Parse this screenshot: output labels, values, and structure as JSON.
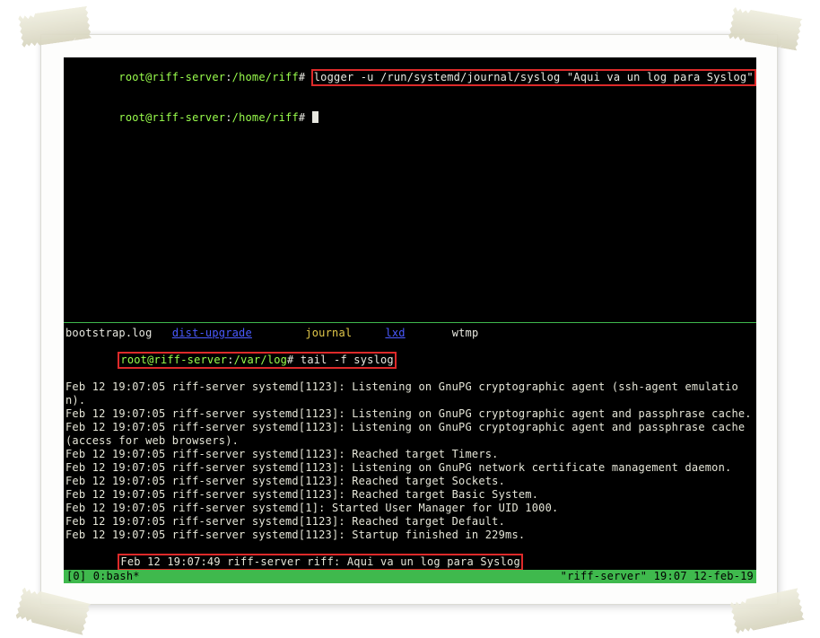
{
  "top_pane": {
    "prompt1": {
      "user_host": "root@riff-server",
      "colon": ":",
      "path": "/home/riff",
      "hash": "# ",
      "command": "logger -u /run/systemd/journal/syslog \"Aqui va un log para Syslog\""
    },
    "prompt2": {
      "user_host": "root@riff-server",
      "colon": ":",
      "path": "/home/riff",
      "hash": "# "
    }
  },
  "bottom_pane": {
    "ls_entries": [
      {
        "text": "bootstrap.log",
        "cls": "ls-white"
      },
      {
        "text": "dist-upgrade",
        "cls": "ls-blue"
      },
      {
        "text": "journal",
        "cls": "ls-yellow"
      },
      {
        "text": "lxd",
        "cls": "ls-blue"
      },
      {
        "text": "wtmp",
        "cls": "ls-white"
      }
    ],
    "prompt": {
      "user_host": "root@riff-server",
      "colon": ":",
      "path": "/var/log",
      "hash": "# ",
      "command": "tail -f syslog"
    },
    "log_lines": [
      "Feb 12 19:07:05 riff-server systemd[1123]: Listening on GnuPG cryptographic agent (ssh-agent emulation).",
      "Feb 12 19:07:05 riff-server systemd[1123]: Listening on GnuPG cryptographic agent and passphrase cache.",
      "Feb 12 19:07:05 riff-server systemd[1123]: Listening on GnuPG cryptographic agent and passphrase cache (access for web browsers).",
      "Feb 12 19:07:05 riff-server systemd[1123]: Reached target Timers.",
      "Feb 12 19:07:05 riff-server systemd[1123]: Listening on GnuPG network certificate management daemon.",
      "Feb 12 19:07:05 riff-server systemd[1123]: Reached target Sockets.",
      "Feb 12 19:07:05 riff-server systemd[1123]: Reached target Basic System.",
      "Feb 12 19:07:05 riff-server systemd[1]: Started User Manager for UID 1000.",
      "Feb 12 19:07:05 riff-server systemd[1123]: Reached target Default.",
      "Feb 12 19:07:05 riff-server systemd[1123]: Startup finished in 229ms."
    ],
    "highlighted_log": "Feb 12 19:07:49 riff-server riff: Aqui va un log para Syslog"
  },
  "status_bar": {
    "left": "[0] 0:bash*",
    "right": "\"riff-server\" 19:07 12-feb-19"
  }
}
